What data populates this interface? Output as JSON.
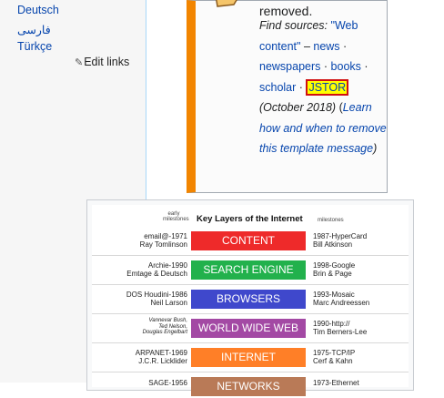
{
  "sidebar": {
    "languages": [
      "Deutsch",
      "فارسی",
      "Türkçe"
    ],
    "edit_links": "Edit links"
  },
  "message": {
    "removed": "removed.",
    "find_sources_label": "Find sources:",
    "query": "\"Web content\"",
    "dash": "–",
    "sep": "·",
    "news": "news",
    "newspapers": "newspapers",
    "books": "books",
    "scholar": "scholar",
    "jstor": "JSTOR",
    "date": "(October 2018)",
    "learn": "Learn how and when to remove this template message",
    "close_paren": ")"
  },
  "figure": {
    "early_label": "early milestones",
    "title": "Key Layers of the Internet",
    "milestones_label": "milestones",
    "layers": [
      {
        "left": [
          "email@-1971",
          "Ray Tomlinson"
        ],
        "label": "CONTENT",
        "right": [
          "1987-HyperCard",
          "Bill Atkinson"
        ],
        "color": "#ee2a2a"
      },
      {
        "left": [
          "Archie-1990",
          "Emtage & Deutsch"
        ],
        "label": "SEARCH ENGINE",
        "right": [
          "1998-Google",
          "Brin & Page"
        ],
        "color": "#22b14c"
      },
      {
        "left": [
          "DOS Houdini-1986",
          "Neil Larson"
        ],
        "label": "BROWSERS",
        "right": [
          "1993-Mosaic",
          "Marc Andreessen"
        ],
        "color": "#3f48cc"
      },
      {
        "left": [
          "Vannevar Bush,",
          "Ted Nelson,",
          "Douglas Engelbart"
        ],
        "label": "WORLD WIDE WEB",
        "right": [
          "1990-http://",
          "Tim Berners-Lee"
        ],
        "color": "#a349a4"
      },
      {
        "left": [
          "ARPANET-1969",
          "J.C.R. Licklider"
        ],
        "label": "INTERNET",
        "right": [
          "1975-TCP/IP",
          "Cerf & Kahn"
        ],
        "color": "#ff7f27"
      },
      {
        "left": [
          "SAGE-1956",
          ""
        ],
        "label": "NETWORKS",
        "right": [
          "1973-Ethernet",
          ""
        ],
        "color": "#b97a57"
      }
    ]
  }
}
